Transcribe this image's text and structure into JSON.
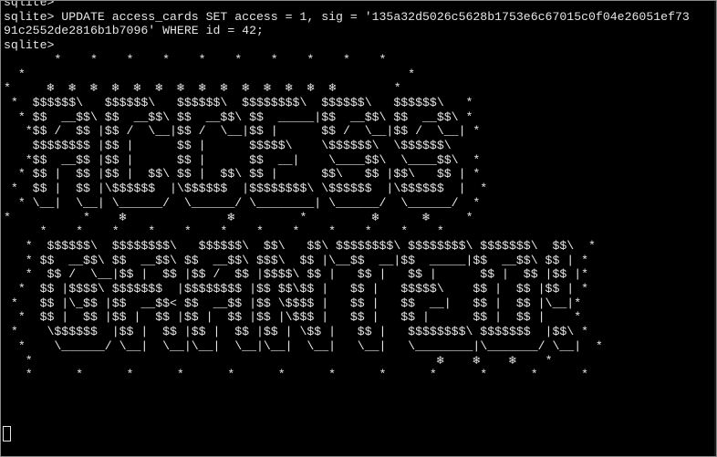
{
  "terminal": {
    "lines": [
      "sqlite> ",
      "sqlite> UPDATE access_cards SET access = 1, sig = '135a32d5026c5628b1753e6c67015c0f04e26051ef73",
      "91c2552de2816b1b7096' WHERE id = 42;",
      "sqlite>",
      "       *    *    *    *    *    *    *    *    *    *",
      "  *                                                     *",
      "*     ❄  ❄  ❄  ❄  ❄  ❄  ❄  ❄  ❄  ❄  ❄  ❄  ❄  ❄        *",
      " *  $$$$$$\\   $$$$$$\\   $$$$$$\\  $$$$$$$$\\  $$$$$$\\   $$$$$$\\   *",
      "  * $$  __$$\\ $$  __$$\\ $$  __$$\\ $$  _____|$$  __$$\\ $$  __$$\\ *",
      "   *$$ /  $$ |$$ /  \\__|$$ /  \\__|$$ |      $$ /  \\__|$$ /  \\__| *",
      "    $$$$$$$$ |$$ |      $$ |      $$$$$\\    \\$$$$$$\\  \\$$$$$$\\",
      "   *$$  __$$ |$$ |      $$ |      $$  __|    \\____$$\\  \\____$$\\  *",
      "  * $$ |  $$ |$$ |  $$\\ $$ |  $$\\ $$ |      $$\\   $$ |$$\\   $$ | *",
      " *  $$ |  $$ |\\$$$$$$  |\\$$$$$$  |$$$$$$$$\\ \\$$$$$$  |\\$$$$$$  |  *",
      "  * \\__|  \\__| \\______/  \\______/ \\________| \\______/  \\______/  *",
      "*          *    ❄              ❄         *         ❄      ❄     *",
      "     *    *    *    *    *    *    *    *    *    *    *    *",
      "   *  $$$$$$\\  $$$$$$$$\\   $$$$$$\\  $$\\   $$\\ $$$$$$$$\\ $$$$$$$$\\ $$$$$$$\\  $$\\  *",
      "   * $$  __$$\\ $$  __$$\\ $$  __$$\\ $$$\\  $$ |\\__$$  __|$$  _____|$$  __$$\\ $$ | *",
      "   *  $$ /  \\__|$$ |  $$ |$$ /  $$ |$$$$\\ $$ |   $$ |   $$ |      $$ |  $$ |$$ |*",
      "  *  $$ |$$$$\\ $$$$$$$  |$$$$$$$$ |$$ $$\\$$ |   $$ |   $$$$$\\    $$ |  $$ |$$ | *",
      " *   $$ |\\_$$ |$$  __$$< $$  __$$ |$$ \\$$$$ |   $$ |   $$  __|   $$ |  $$ |\\__|*",
      "  *  $$ |  $$ |$$ |  $$ |$$ |  $$ |$$ |\\$$$ |   $$ |   $$ |      $$ |  $$ |    *",
      " *    \\$$$$$$  |$$ |  $$ |$$ |  $$ |$$ | \\$$ |   $$ |   $$$$$$$$\\ $$$$$$$  |$$\\ *",
      "  *    \\______/ \\__|  \\__|\\__|  \\__|\\__|  \\__|   \\__|   \\________|\\_______/ \\__|  *",
      "   *                                                        ❄    ❄    ❄    *",
      "   *      *      *      *      *      *      *      *      *      *      *      *",
      "",
      "",
      ""
    ]
  },
  "icons": {
    "cursor": "block-cursor-icon"
  },
  "colors": {
    "background": "#000000",
    "foreground": "#e6e6e6"
  }
}
